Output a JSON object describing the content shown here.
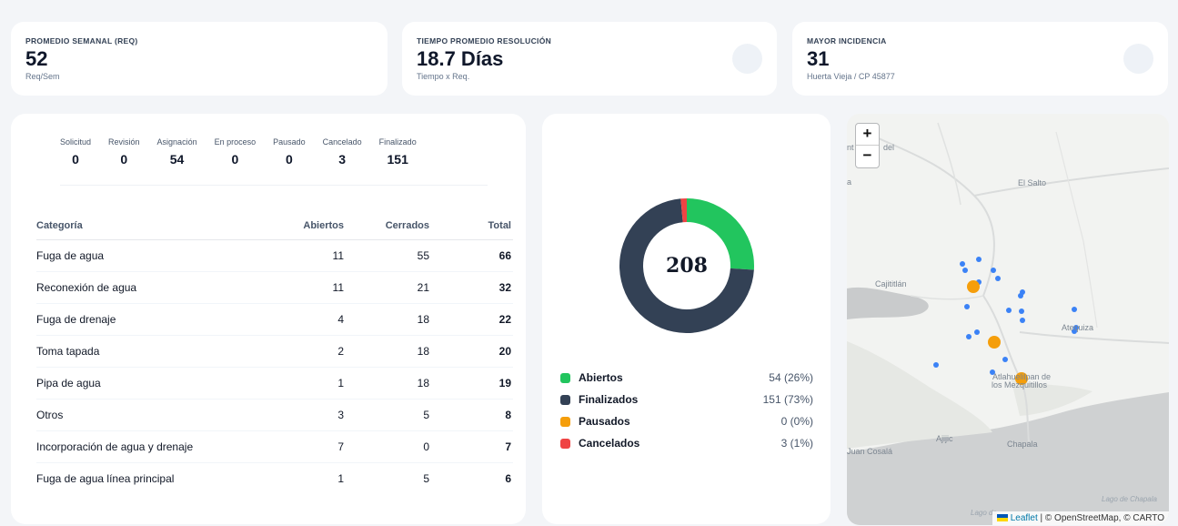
{
  "kpis": [
    {
      "label": "PROMEDIO SEMANAL (REQ)",
      "value": "52",
      "sub": "Req/Sem"
    },
    {
      "label": "TIEMPO PROMEDIO RESOLUCIÓN",
      "value": "18.7 Días",
      "sub": "Tiempo x Req."
    },
    {
      "label": "MAYOR INCIDENCIA",
      "value": "31",
      "sub": "Huerta Vieja / CP 45877"
    }
  ],
  "statuses": [
    {
      "label": "Solicitud",
      "value": "0"
    },
    {
      "label": "Revisión",
      "value": "0"
    },
    {
      "label": "Asignación",
      "value": "54"
    },
    {
      "label": "En proceso",
      "value": "0"
    },
    {
      "label": "Pausado",
      "value": "0"
    },
    {
      "label": "Cancelado",
      "value": "3"
    },
    {
      "label": "Finalizado",
      "value": "151"
    }
  ],
  "table": {
    "headers": {
      "category": "Categoría",
      "open": "Abiertos",
      "closed": "Cerrados",
      "total": "Total"
    },
    "rows": [
      {
        "category": "Fuga de agua",
        "open": "11",
        "closed": "55",
        "total": "66"
      },
      {
        "category": "Reconexión de agua",
        "open": "11",
        "closed": "21",
        "total": "32"
      },
      {
        "category": "Fuga de drenaje",
        "open": "4",
        "closed": "18",
        "total": "22"
      },
      {
        "category": "Toma tapada",
        "open": "2",
        "closed": "18",
        "total": "20"
      },
      {
        "category": "Pipa de agua",
        "open": "1",
        "closed": "18",
        "total": "19"
      },
      {
        "category": "Otros",
        "open": "3",
        "closed": "5",
        "total": "8"
      },
      {
        "category": "Incorporación de agua y drenaje",
        "open": "7",
        "closed": "0",
        "total": "7"
      },
      {
        "category": "Fuga de agua línea principal",
        "open": "1",
        "closed": "5",
        "total": "6"
      }
    ]
  },
  "donut": {
    "total_label": "208",
    "segments": [
      {
        "name": "Abiertos",
        "value": 54,
        "label": "54 (26%)",
        "color": "#22c55e"
      },
      {
        "name": "Finalizados",
        "value": 151,
        "label": "151 (73%)",
        "color": "#334155"
      },
      {
        "name": "Pausados",
        "value": 0,
        "label": "0 (0%)",
        "color": "#f59e0b"
      },
      {
        "name": "Cancelados",
        "value": 3,
        "label": "3 (1%)",
        "color": "#ef4444"
      }
    ]
  },
  "map": {
    "zoom_in": "+",
    "zoom_out": "−",
    "labels": {
      "ent": "nt",
      "del": "del",
      "a": "a",
      "el_salto": "El Salto",
      "cajititlan": "Cajititlán",
      "atequiza": "Atequiza",
      "tlahuelilpan": "Atlahuelilpan de",
      "mezquitillos": "los Mezquitillos",
      "ajijic": "Ajijic",
      "chapala": "Chapala",
      "juan_cosala": "Juan Cosalá",
      "lago_chapala": "Lago de Chapala",
      "lago_de": "Lago de"
    },
    "marker_colors": {
      "open": "#3b82f6",
      "paused": "#f59e0b"
    },
    "attribution": {
      "leaflet": "Leaflet",
      "rest": " | © OpenStreetMap, © CARTO"
    }
  }
}
